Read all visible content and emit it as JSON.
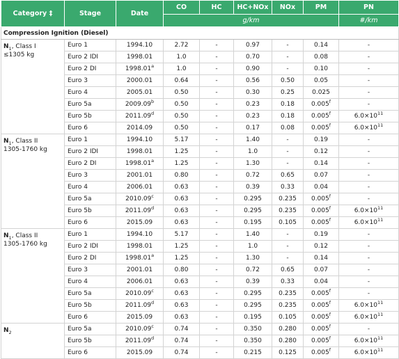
{
  "headers": {
    "category": "Category",
    "category_mark": "‡",
    "stage": "Stage",
    "date": "Date",
    "co": "CO",
    "hc": "HC",
    "hcnox": "HC+NOx",
    "nox": "NOx",
    "pm": "PM",
    "pn": "PN",
    "unit_mass": "g/km",
    "unit_count": "#/km"
  },
  "group_label": "Compression Ignition (Diesel)",
  "categories": [
    {
      "prefix": "N",
      "sub": "1",
      "suffix": ", Class I",
      "weight": "≤1305 kg",
      "rows": [
        {
          "stage": "Euro 1",
          "date": "1994.10",
          "date_sup": "",
          "co": "2.72",
          "hc": "-",
          "hcnox": "0.97",
          "nox": "-",
          "pm": "0.14",
          "pm_sup": "",
          "pn": "-",
          "pn_exp": ""
        },
        {
          "stage": "Euro 2 IDI",
          "date": "1998.01",
          "date_sup": "",
          "co": "1.0",
          "hc": "-",
          "hcnox": "0.70",
          "nox": "-",
          "pm": "0.08",
          "pm_sup": "",
          "pn": "-",
          "pn_exp": ""
        },
        {
          "stage": "Euro 2 DI",
          "date": "1998.01",
          "date_sup": "a",
          "co": "1.0",
          "hc": "-",
          "hcnox": "0.90",
          "nox": "-",
          "pm": "0.10",
          "pm_sup": "",
          "pn": "-",
          "pn_exp": ""
        },
        {
          "stage": "Euro 3",
          "date": "2000.01",
          "date_sup": "",
          "co": "0.64",
          "hc": "-",
          "hcnox": "0.56",
          "nox": "0.50",
          "pm": "0.05",
          "pm_sup": "",
          "pn": "-",
          "pn_exp": ""
        },
        {
          "stage": "Euro 4",
          "date": "2005.01",
          "date_sup": "",
          "co": "0.50",
          "hc": "-",
          "hcnox": "0.30",
          "nox": "0.25",
          "pm": "0.025",
          "pm_sup": "",
          "pn": "-",
          "pn_exp": ""
        },
        {
          "stage": "Euro 5a",
          "date": "2009.09",
          "date_sup": "b",
          "co": "0.50",
          "hc": "-",
          "hcnox": "0.23",
          "nox": "0.18",
          "pm": "0.005",
          "pm_sup": "f",
          "pn": "-",
          "pn_exp": ""
        },
        {
          "stage": "Euro 5b",
          "date": "2011.09",
          "date_sup": "d",
          "co": "0.50",
          "hc": "-",
          "hcnox": "0.23",
          "nox": "0.18",
          "pm": "0.005",
          "pm_sup": "f",
          "pn": "6.0×10",
          "pn_exp": "11"
        },
        {
          "stage": "Euro 6",
          "date": "2014.09",
          "date_sup": "",
          "co": "0.50",
          "hc": "-",
          "hcnox": "0.17",
          "nox": "0.08",
          "pm": "0.005",
          "pm_sup": "f",
          "pn": "6.0×10",
          "pn_exp": "11"
        }
      ]
    },
    {
      "prefix": "N",
      "sub": "1",
      "suffix": ", Class II",
      "weight": "1305-1760 kg",
      "rows": [
        {
          "stage": "Euro 1",
          "date": "1994.10",
          "date_sup": "",
          "co": "5.17",
          "hc": "-",
          "hcnox": "1.40",
          "nox": "-",
          "pm": "0.19",
          "pm_sup": "",
          "pn": "-",
          "pn_exp": ""
        },
        {
          "stage": "Euro 2 IDI",
          "date": "1998.01",
          "date_sup": "",
          "co": "1.25",
          "hc": "-",
          "hcnox": "1.0",
          "nox": "-",
          "pm": "0.12",
          "pm_sup": "",
          "pn": "-",
          "pn_exp": ""
        },
        {
          "stage": "Euro 2 DI",
          "date": "1998.01",
          "date_sup": "a",
          "co": "1.25",
          "hc": "-",
          "hcnox": "1.30",
          "nox": "-",
          "pm": "0.14",
          "pm_sup": "",
          "pn": "-",
          "pn_exp": ""
        },
        {
          "stage": "Euro 3",
          "date": "2001.01",
          "date_sup": "",
          "co": "0.80",
          "hc": "-",
          "hcnox": "0.72",
          "nox": "0.65",
          "pm": "0.07",
          "pm_sup": "",
          "pn": "-",
          "pn_exp": ""
        },
        {
          "stage": "Euro 4",
          "date": "2006.01",
          "date_sup": "",
          "co": "0.63",
          "hc": "-",
          "hcnox": "0.39",
          "nox": "0.33",
          "pm": "0.04",
          "pm_sup": "",
          "pn": "-",
          "pn_exp": ""
        },
        {
          "stage": "Euro 5a",
          "date": "2010.09",
          "date_sup": "c",
          "co": "0.63",
          "hc": "-",
          "hcnox": "0.295",
          "nox": "0.235",
          "pm": "0.005",
          "pm_sup": "f",
          "pn": "-",
          "pn_exp": ""
        },
        {
          "stage": "Euro 5b",
          "date": "2011.09",
          "date_sup": "d",
          "co": "0.63",
          "hc": "-",
          "hcnox": "0.295",
          "nox": "0.235",
          "pm": "0.005",
          "pm_sup": "f",
          "pn": "6.0×10",
          "pn_exp": "11"
        },
        {
          "stage": "Euro 6",
          "date": "2015.09",
          "date_sup": "",
          "co": "0.63",
          "hc": "-",
          "hcnox": "0.195",
          "nox": "0.105",
          "pm": "0.005",
          "pm_sup": "f",
          "pn": "6.0×10",
          "pn_exp": "11"
        }
      ]
    },
    {
      "prefix": "N",
      "sub": "1",
      "suffix": ", Class II",
      "weight": "1305-1760 kg",
      "rows": [
        {
          "stage": "Euro 1",
          "date": "1994.10",
          "date_sup": "",
          "co": "5.17",
          "hc": "-",
          "hcnox": "1.40",
          "nox": "-",
          "pm": "0.19",
          "pm_sup": "",
          "pn": "-",
          "pn_exp": ""
        },
        {
          "stage": "Euro 2 IDI",
          "date": "1998.01",
          "date_sup": "",
          "co": "1.25",
          "hc": "-",
          "hcnox": "1.0",
          "nox": "-",
          "pm": "0.12",
          "pm_sup": "",
          "pn": "-",
          "pn_exp": ""
        },
        {
          "stage": "Euro 2 DI",
          "date": "1998.01",
          "date_sup": "a",
          "co": "1.25",
          "hc": "-",
          "hcnox": "1.30",
          "nox": "-",
          "pm": "0.14",
          "pm_sup": "",
          "pn": "-",
          "pn_exp": ""
        },
        {
          "stage": "Euro 3",
          "date": "2001.01",
          "date_sup": "",
          "co": "0.80",
          "hc": "-",
          "hcnox": "0.72",
          "nox": "0.65",
          "pm": "0.07",
          "pm_sup": "",
          "pn": "-",
          "pn_exp": ""
        },
        {
          "stage": "Euro 4",
          "date": "2006.01",
          "date_sup": "",
          "co": "0.63",
          "hc": "-",
          "hcnox": "0.39",
          "nox": "0.33",
          "pm": "0.04",
          "pm_sup": "",
          "pn": "-",
          "pn_exp": ""
        },
        {
          "stage": "Euro 5a",
          "date": "2010.09",
          "date_sup": "c",
          "co": "0.63",
          "hc": "-",
          "hcnox": "0.295",
          "nox": "0.235",
          "pm": "0.005",
          "pm_sup": "f",
          "pn": "-",
          "pn_exp": ""
        },
        {
          "stage": "Euro 5b",
          "date": "2011.09",
          "date_sup": "d",
          "co": "0.63",
          "hc": "-",
          "hcnox": "0.295",
          "nox": "0.235",
          "pm": "0.005",
          "pm_sup": "f",
          "pn": "6.0×10",
          "pn_exp": "11"
        },
        {
          "stage": "Euro 6",
          "date": "2015.09",
          "date_sup": "",
          "co": "0.63",
          "hc": "-",
          "hcnox": "0.195",
          "nox": "0.105",
          "pm": "0.005",
          "pm_sup": "f",
          "pn": "6.0×10",
          "pn_exp": "11"
        }
      ]
    },
    {
      "prefix": "N",
      "sub": "2",
      "suffix": "",
      "weight": "",
      "rows": [
        {
          "stage": "Euro 5a",
          "date": "2010.09",
          "date_sup": "c",
          "co": "0.74",
          "hc": "-",
          "hcnox": "0.350",
          "nox": "0.280",
          "pm": "0.005",
          "pm_sup": "f",
          "pn": "-",
          "pn_exp": ""
        },
        {
          "stage": "Euro 5b",
          "date": "2011.09",
          "date_sup": "d",
          "co": "0.74",
          "hc": "-",
          "hcnox": "0.350",
          "nox": "0.280",
          "pm": "0.005",
          "pm_sup": "f",
          "pn": "6.0×10",
          "pn_exp": "11"
        },
        {
          "stage": "Euro 6",
          "date": "2015.09",
          "date_sup": "",
          "co": "0.74",
          "hc": "-",
          "hcnox": "0.215",
          "nox": "0.125",
          "pm": "0.005",
          "pm_sup": "f",
          "pn": "6.0×10",
          "pn_exp": "11"
        }
      ]
    }
  ],
  "colors": {
    "header_bg": "#3aa96e",
    "header_text": "#ffffff",
    "border": "#d3d3d3"
  }
}
